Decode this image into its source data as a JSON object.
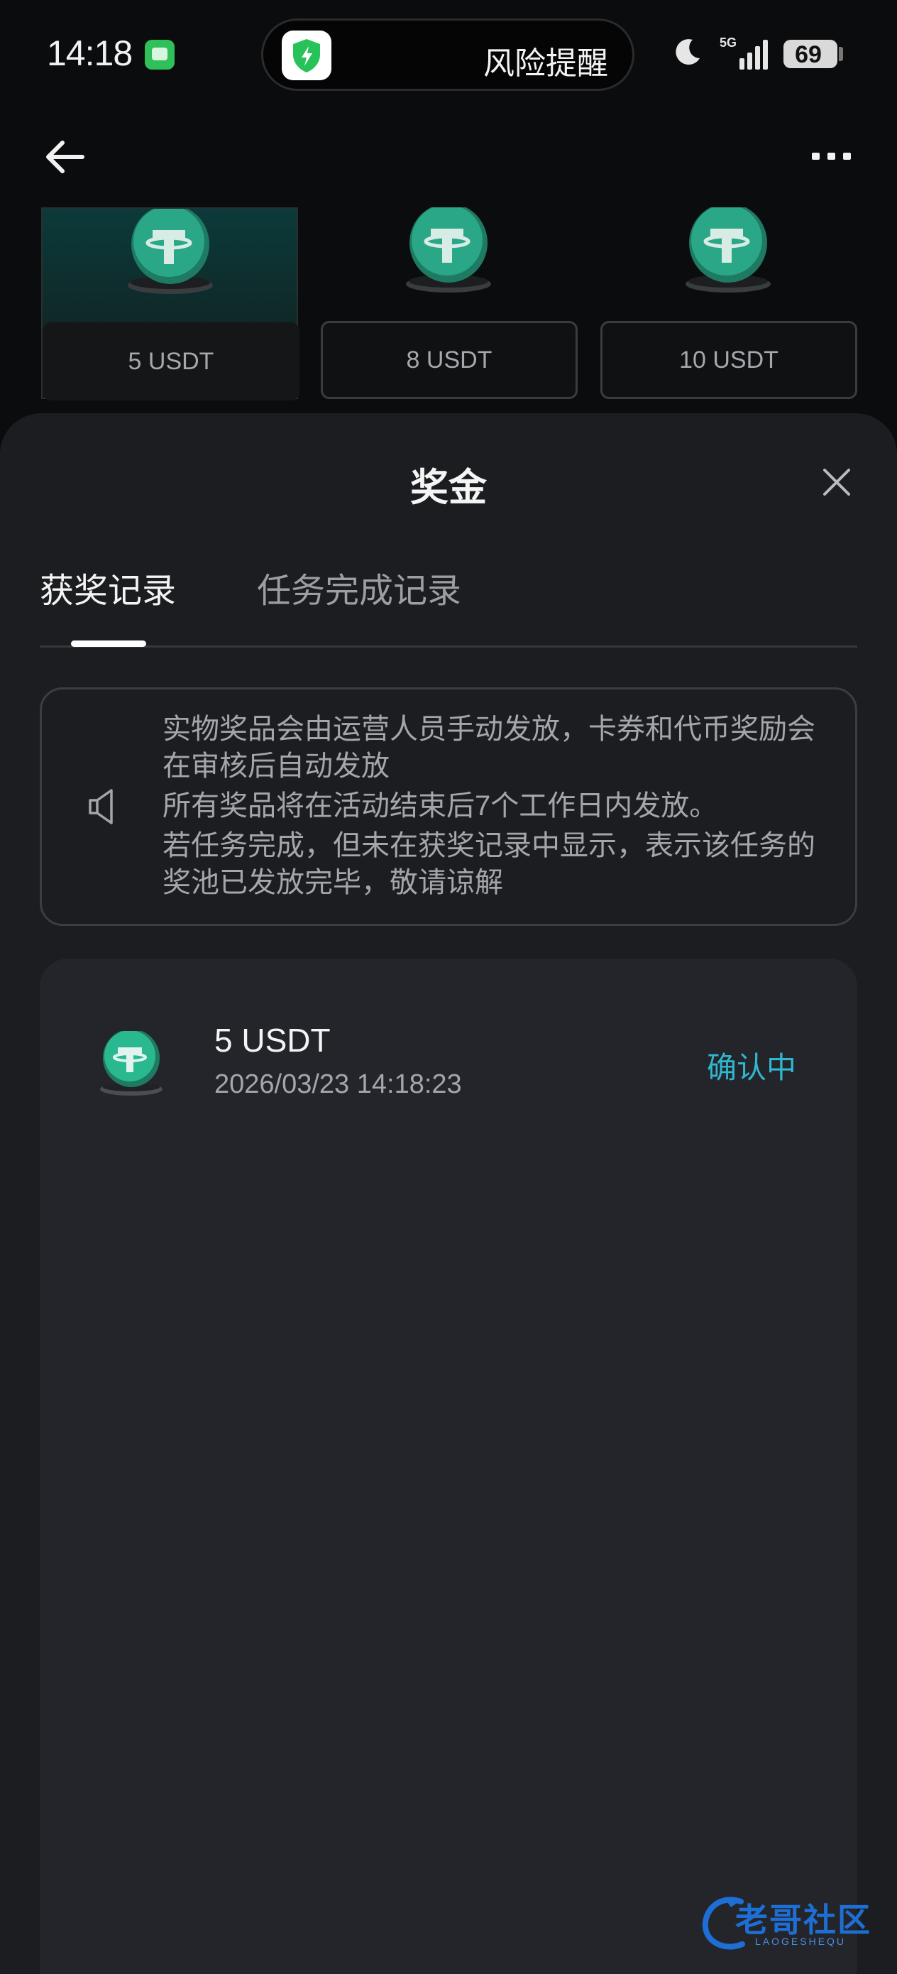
{
  "status_bar": {
    "time": "14:18",
    "alert_text": "风险提醒",
    "network": "5G",
    "battery": "69",
    "battery_level": 0.69
  },
  "prizes": [
    {
      "label": "5 USDT",
      "selected": true
    },
    {
      "label": "8 USDT",
      "selected": false
    },
    {
      "label": "10 USDT",
      "selected": false
    }
  ],
  "sheet": {
    "title": "奖金",
    "tabs": [
      {
        "label": "获奖记录",
        "active": true
      },
      {
        "label": "任务完成记录",
        "active": false
      }
    ],
    "notice": {
      "line1": "实物奖品会由运营人员手动发放，卡券和代币奖励会在审核后自动发放",
      "line2": "所有奖品将在活动结束后7个工作日内发放。",
      "line3": "若任务完成，但未在获奖记录中显示，表示该任务的奖池已发放完毕，敬请谅解"
    },
    "records": [
      {
        "amount": "5 USDT",
        "time": "2026/03/23 14:18:23",
        "status": "确认中"
      }
    ]
  },
  "watermark": {
    "text": "老哥社区",
    "sub": "LAOGESHEQU"
  },
  "colors": {
    "accent": "#2fb7cf",
    "background": "#0b0c0e",
    "sheet": "#1c1d20",
    "card": "#24252a",
    "coin": "#2aa786"
  }
}
